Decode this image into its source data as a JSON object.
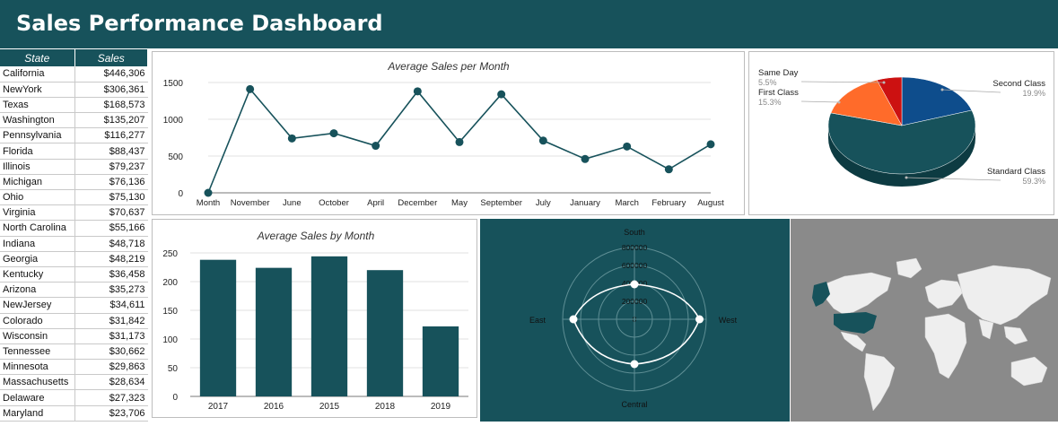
{
  "header": {
    "title": "Sales Performance Dashboard"
  },
  "table": {
    "headers": {
      "state": "State",
      "sales": "Sales"
    },
    "rows": [
      {
        "state": "California",
        "sales": "$446,306"
      },
      {
        "state": "NewYork",
        "sales": "$306,361"
      },
      {
        "state": "Texas",
        "sales": "$168,573"
      },
      {
        "state": "Washington",
        "sales": "$135,207"
      },
      {
        "state": "Pennsylvania",
        "sales": "$116,277"
      },
      {
        "state": "Florida",
        "sales": "$88,437"
      },
      {
        "state": "Illinois",
        "sales": "$79,237"
      },
      {
        "state": "Michigan",
        "sales": "$76,136"
      },
      {
        "state": "Ohio",
        "sales": "$75,130"
      },
      {
        "state": "Virginia",
        "sales": "$70,637"
      },
      {
        "state": "North Carolina",
        "sales": "$55,166"
      },
      {
        "state": "Indiana",
        "sales": "$48,718"
      },
      {
        "state": "Georgia",
        "sales": "$48,219"
      },
      {
        "state": "Kentucky",
        "sales": "$36,458"
      },
      {
        "state": "Arizona",
        "sales": "$35,273"
      },
      {
        "state": "NewJersey",
        "sales": "$34,611"
      },
      {
        "state": "Colorado",
        "sales": "$31,842"
      },
      {
        "state": "Wisconsin",
        "sales": "$31,173"
      },
      {
        "state": "Tennessee",
        "sales": "$30,662"
      },
      {
        "state": "Minnesota",
        "sales": "$29,863"
      },
      {
        "state": "Massachusetts",
        "sales": "$28,634"
      },
      {
        "state": "Delaware",
        "sales": "$27,323"
      },
      {
        "state": "Maryland",
        "sales": "$23,706"
      }
    ]
  },
  "colors": {
    "accent": "#17525b",
    "header_text": "#ffffff",
    "map_bg": "#8a8a8a",
    "land": "#eeeeee",
    "radar_line": "#ffffff"
  },
  "chart_data": [
    {
      "type": "line",
      "title": "Average Sales per Month",
      "categories": [
        "Month",
        "November",
        "June",
        "October",
        "April",
        "December",
        "May",
        "September",
        "July",
        "January",
        "March",
        "February",
        "August"
      ],
      "values": [
        0,
        1410,
        740,
        810,
        640,
        1380,
        690,
        1340,
        710,
        460,
        630,
        320,
        660
      ],
      "ylim": [
        0,
        1500
      ],
      "yticks": [
        "0",
        "500",
        "1000",
        "1500"
      ],
      "yticks_values": [
        0,
        500,
        1000,
        1500
      ],
      "grid": true,
      "color": "#17525b"
    },
    {
      "type": "pie",
      "slices": [
        {
          "label": "Standard Class",
          "value": 59.3,
          "pct": "59.3%",
          "color": "#17525b"
        },
        {
          "label": "Second Class",
          "value": 19.9,
          "pct": "19.9%",
          "color": "#0e4d8c"
        },
        {
          "label": "Same Day",
          "value": 5.5,
          "pct": "5.5%",
          "color": "#cc1111"
        },
        {
          "label": "First Class",
          "value": 15.3,
          "pct": "15.3%",
          "color": "#ff6b2a"
        }
      ],
      "legend": "callouts"
    },
    {
      "type": "bar",
      "title": "Average Sales by Month",
      "categories": [
        "2017",
        "2016",
        "2015",
        "2018",
        "2019"
      ],
      "values": [
        238,
        224,
        244,
        220,
        122
      ],
      "ylim": [
        0,
        250
      ],
      "yticks": [
        "0",
        "50",
        "100",
        "150",
        "200",
        "250"
      ],
      "yticks_values": [
        0,
        50,
        100,
        150,
        200,
        250
      ],
      "grid": true,
      "color": "#17525b"
    },
    {
      "type": "radar",
      "axes": [
        "South",
        "West",
        "Central",
        "East"
      ],
      "values": [
        390000,
        725000,
        500000,
        680000
      ],
      "rmax": 800000,
      "rticks": [
        "0",
        "200000",
        "400000",
        "600000",
        "800000"
      ],
      "rticks_values": [
        0,
        200000,
        400000,
        600000,
        800000
      ]
    }
  ],
  "map": {
    "highlighted": "United States"
  }
}
